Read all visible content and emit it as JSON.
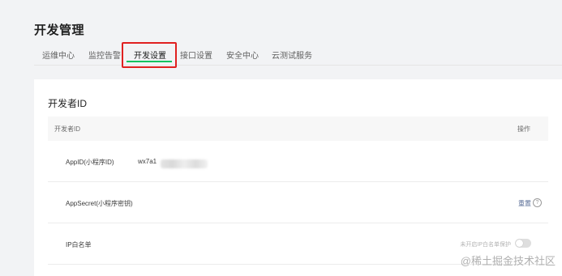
{
  "page": {
    "title": "开发管理"
  },
  "tabs": [
    {
      "label": "运维中心"
    },
    {
      "label": "监控告警"
    },
    {
      "label": "开发设置"
    },
    {
      "label": "接口设置"
    },
    {
      "label": "安全中心"
    },
    {
      "label": "云测试服务"
    }
  ],
  "active_tab": "开发设置",
  "section": {
    "title": "开发者ID",
    "table": {
      "headers": {
        "name": "开发者ID",
        "action": "操作"
      },
      "rows": [
        {
          "label": "AppID(小程序ID)",
          "value": "wx7a1"
        },
        {
          "label": "AppSecret(小程序密钥)",
          "action": "重置"
        },
        {
          "label": "IP白名单",
          "status": "未开启IP白名单保护"
        }
      ]
    }
  },
  "icons": {
    "help": "?"
  },
  "colors": {
    "accent": "#07c160",
    "link": "#576b95",
    "highlight": "#e02020"
  },
  "watermark": "@稀土掘金技术社区"
}
